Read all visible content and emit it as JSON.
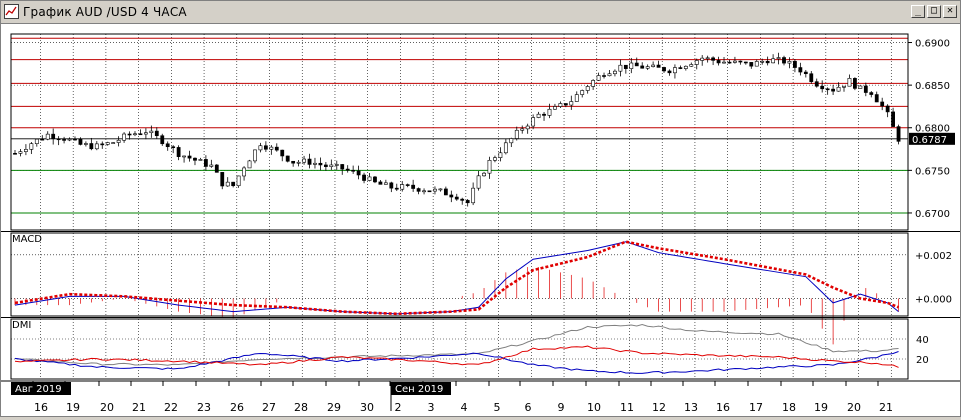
{
  "window": {
    "title": "График AUD /USD  4 ЧАСА",
    "buttons": {
      "minimize": "_",
      "maximize": "□",
      "close": "✕"
    },
    "icons": {
      "app": "chart-app-icon"
    }
  },
  "price_panel": {
    "current_price": "0.6787",
    "price_labels": [
      "0.6900",
      "0.6850",
      "0.6800",
      "0.6750",
      "0.6700"
    ]
  },
  "macd_panel": {
    "title": "MACD",
    "labels": [
      "+0.002",
      "+0.000"
    ]
  },
  "dmi_panel": {
    "title": "DMI",
    "labels": [
      "40",
      "20"
    ]
  },
  "time_axis": {
    "month_labels": [
      "Авг 2019",
      "Сен 2019"
    ],
    "day_labels": [
      "16",
      "19",
      "20",
      "21",
      "22",
      "23",
      "26",
      "27",
      "28",
      "29",
      "30",
      "2",
      "3",
      "4",
      "5",
      "6",
      "9",
      "10",
      "11",
      "12",
      "13",
      "16",
      "17",
      "18",
      "19",
      "20",
      "21"
    ]
  },
  "colors": {
    "resistance_line": "#c00000",
    "support_line": "#008000",
    "macd_line": "#0000c0",
    "signal_line": "#e00000",
    "dmi_adx": "#808080",
    "dmi_plus": "#0000c0",
    "dmi_minus": "#e00000",
    "grid": "#000000"
  },
  "chart_data": {
    "type": "candlestick",
    "symbol": "AUD/USD",
    "timeframe": "4H",
    "price_ylim": [
      0.668,
      0.691
    ],
    "resistance_levels": [
      0.6905,
      0.688,
      0.6852,
      0.6825,
      0.68
    ],
    "support_levels": [
      0.675,
      0.67
    ],
    "close_path": [
      [
        0,
        0.677
      ],
      [
        3,
        0.6782
      ],
      [
        6,
        0.6792
      ],
      [
        9,
        0.6788
      ],
      [
        12,
        0.678
      ],
      [
        15,
        0.6778
      ],
      [
        18,
        0.6783
      ],
      [
        21,
        0.6792
      ],
      [
        24,
        0.6796
      ],
      [
        27,
        0.6785
      ],
      [
        30,
        0.677
      ],
      [
        33,
        0.6762
      ],
      [
        36,
        0.6755
      ],
      [
        38,
        0.6735
      ],
      [
        40,
        0.6732
      ],
      [
        42,
        0.6755
      ],
      [
        45,
        0.6782
      ],
      [
        48,
        0.6772
      ],
      [
        51,
        0.676
      ],
      [
        54,
        0.676
      ],
      [
        57,
        0.6755
      ],
      [
        60,
        0.6752
      ],
      [
        63,
        0.6745
      ],
      [
        66,
        0.6735
      ],
      [
        69,
        0.673
      ],
      [
        72,
        0.673
      ],
      [
        75,
        0.6728
      ],
      [
        78,
        0.6725
      ],
      [
        81,
        0.672
      ],
      [
        83,
        0.6712
      ],
      [
        85,
        0.674
      ],
      [
        87,
        0.676
      ],
      [
        90,
        0.678
      ],
      [
        93,
        0.68
      ],
      [
        96,
        0.6815
      ],
      [
        99,
        0.6822
      ],
      [
        102,
        0.6832
      ],
      [
        105,
        0.685
      ],
      [
        108,
        0.6865
      ],
      [
        111,
        0.6872
      ],
      [
        114,
        0.6872
      ],
      [
        117,
        0.687
      ],
      [
        120,
        0.6868
      ],
      [
        123,
        0.6875
      ],
      [
        126,
        0.6882
      ],
      [
        129,
        0.6878
      ],
      [
        132,
        0.6876
      ],
      [
        135,
        0.6874
      ],
      [
        138,
        0.688
      ],
      [
        141,
        0.6878
      ],
      [
        144,
        0.6868
      ],
      [
        147,
        0.6852
      ],
      [
        150,
        0.6845
      ],
      [
        153,
        0.6855
      ],
      [
        155,
        0.6845
      ],
      [
        157,
        0.6842
      ],
      [
        159,
        0.6825
      ],
      [
        160,
        0.6815
      ],
      [
        161,
        0.68
      ],
      [
        162,
        0.6787
      ]
    ],
    "macd": {
      "ylim": [
        -0.0008,
        0.003
      ],
      "macd_path": [
        [
          0,
          -0.0003
        ],
        [
          10,
          0.0001
        ],
        [
          20,
          0.0001
        ],
        [
          30,
          -0.0003
        ],
        [
          40,
          -0.0006
        ],
        [
          50,
          -0.0004
        ],
        [
          60,
          -0.0006
        ],
        [
          70,
          -0.0007
        ],
        [
          80,
          -0.0006
        ],
        [
          85,
          -0.0004
        ],
        [
          90,
          0.0009
        ],
        [
          95,
          0.0018
        ],
        [
          105,
          0.0022
        ],
        [
          112,
          0.0026
        ],
        [
          118,
          0.0021
        ],
        [
          130,
          0.0016
        ],
        [
          145,
          0.001
        ],
        [
          150,
          -0.0002
        ],
        [
          155,
          0.0002
        ],
        [
          160,
          -0.0002
        ],
        [
          162,
          -0.0006
        ]
      ],
      "signal_path": [
        [
          0,
          -0.0002
        ],
        [
          10,
          0.0002
        ],
        [
          20,
          0.0001
        ],
        [
          30,
          -0.0001
        ],
        [
          40,
          -0.0003
        ],
        [
          50,
          -0.0004
        ],
        [
          60,
          -0.0006
        ],
        [
          70,
          -0.0007
        ],
        [
          80,
          -0.0006
        ],
        [
          85,
          -0.0005
        ],
        [
          90,
          0.0005
        ],
        [
          95,
          0.0013
        ],
        [
          105,
          0.0019
        ],
        [
          112,
          0.0026
        ],
        [
          118,
          0.0023
        ],
        [
          130,
          0.0018
        ],
        [
          145,
          0.0011
        ],
        [
          150,
          0.0005
        ],
        [
          155,
          0.0
        ],
        [
          160,
          -0.0002
        ],
        [
          162,
          -0.0004
        ]
      ]
    },
    "dmi": {
      "ylim": [
        0,
        60
      ],
      "adx_path": [
        [
          0,
          20
        ],
        [
          15,
          15
        ],
        [
          30,
          14
        ],
        [
          45,
          20
        ],
        [
          60,
          22
        ],
        [
          75,
          24
        ],
        [
          85,
          25
        ],
        [
          95,
          38
        ],
        [
          105,
          52
        ],
        [
          115,
          54
        ],
        [
          125,
          48
        ],
        [
          140,
          45
        ],
        [
          150,
          28
        ],
        [
          158,
          28
        ],
        [
          162,
          30
        ]
      ],
      "plus_di_path": [
        [
          0,
          20
        ],
        [
          15,
          12
        ],
        [
          30,
          10
        ],
        [
          45,
          26
        ],
        [
          60,
          18
        ],
        [
          75,
          22
        ],
        [
          85,
          26
        ],
        [
          95,
          14
        ],
        [
          105,
          8
        ],
        [
          115,
          6
        ],
        [
          125,
          8
        ],
        [
          140,
          12
        ],
        [
          150,
          14
        ],
        [
          158,
          22
        ],
        [
          162,
          28
        ]
      ],
      "minus_di_path": [
        [
          0,
          17
        ],
        [
          15,
          20
        ],
        [
          30,
          18
        ],
        [
          45,
          14
        ],
        [
          60,
          22
        ],
        [
          75,
          18
        ],
        [
          85,
          14
        ],
        [
          95,
          30
        ],
        [
          105,
          32
        ],
        [
          115,
          26
        ],
        [
          125,
          24
        ],
        [
          140,
          22
        ],
        [
          150,
          18
        ],
        [
          158,
          16
        ],
        [
          162,
          12
        ]
      ]
    }
  }
}
